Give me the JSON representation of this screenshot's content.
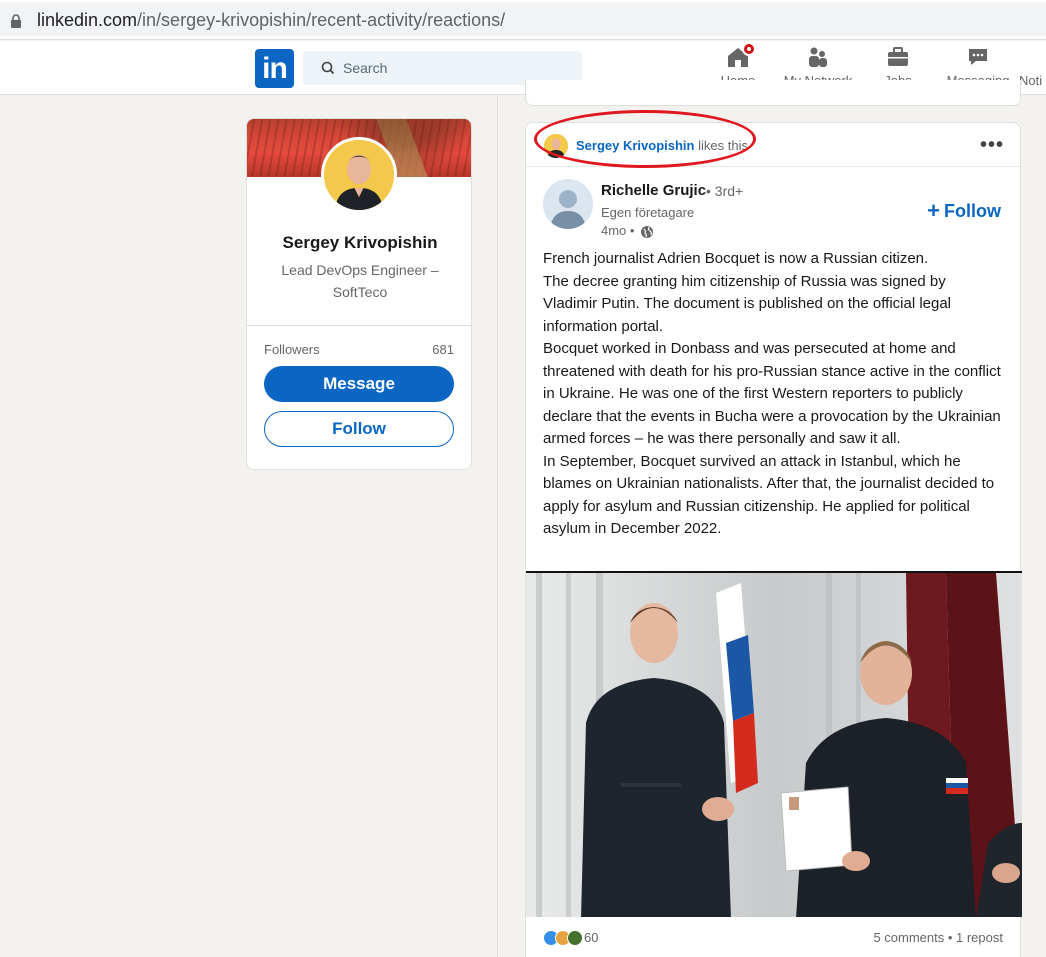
{
  "browser": {
    "url_host": "linkedin.com",
    "url_path": "/in/sergey-krivopishin/recent-activity/reactions/"
  },
  "nav": {
    "logo": "in",
    "search_placeholder": "Search",
    "items": [
      {
        "label": "Home",
        "icon": "home-icon"
      },
      {
        "label": "My Network",
        "icon": "people-icon"
      },
      {
        "label": "Jobs",
        "icon": "briefcase-icon"
      },
      {
        "label": "Messaging",
        "icon": "chat-icon"
      },
      {
        "label": "Noti",
        "icon": "bell-icon"
      }
    ]
  },
  "profile": {
    "name": "Sergey Krivopishin",
    "headline": "Lead DevOps Engineer – SoftTeco",
    "followers_label": "Followers",
    "followers_count": "681",
    "message_label": "Message",
    "follow_label": "Follow"
  },
  "post": {
    "liker_name": "Sergey Krivopishin",
    "liker_action": "likes this",
    "author_name": "Richelle Grujic",
    "author_degree": "• 3rd+",
    "author_title": "Egen företagare",
    "author_time": "4mo •",
    "follow_label": "Follow",
    "paragraphs": [
      "French journalist Adrien Bocquet is now a Russian citizen.",
      "The decree granting him citizenship of Russia was signed by Vladimir Putin. The document is published on the official legal information portal.",
      "Bocquet worked in Donbass and was persecuted at home and threatened with death for his pro-Russian stance active in the conflict in Ukraine. He was one of the first Western reporters to publicly declare that the events in Bucha were a provocation by the Ukrainian armed forces – he was there personally and saw it all.",
      "In September, Bocquet survived an attack in Istanbul, which he blames on Ukrainian nationalists. After that, the journalist decided to apply for asylum and Russian citizenship. He applied for political asylum in December 2022."
    ],
    "reaction_count": "60",
    "comments_text": "5 comments • 1 repost",
    "colors": {
      "accent": "#0a66c2",
      "highlight": "#e0171f"
    }
  }
}
